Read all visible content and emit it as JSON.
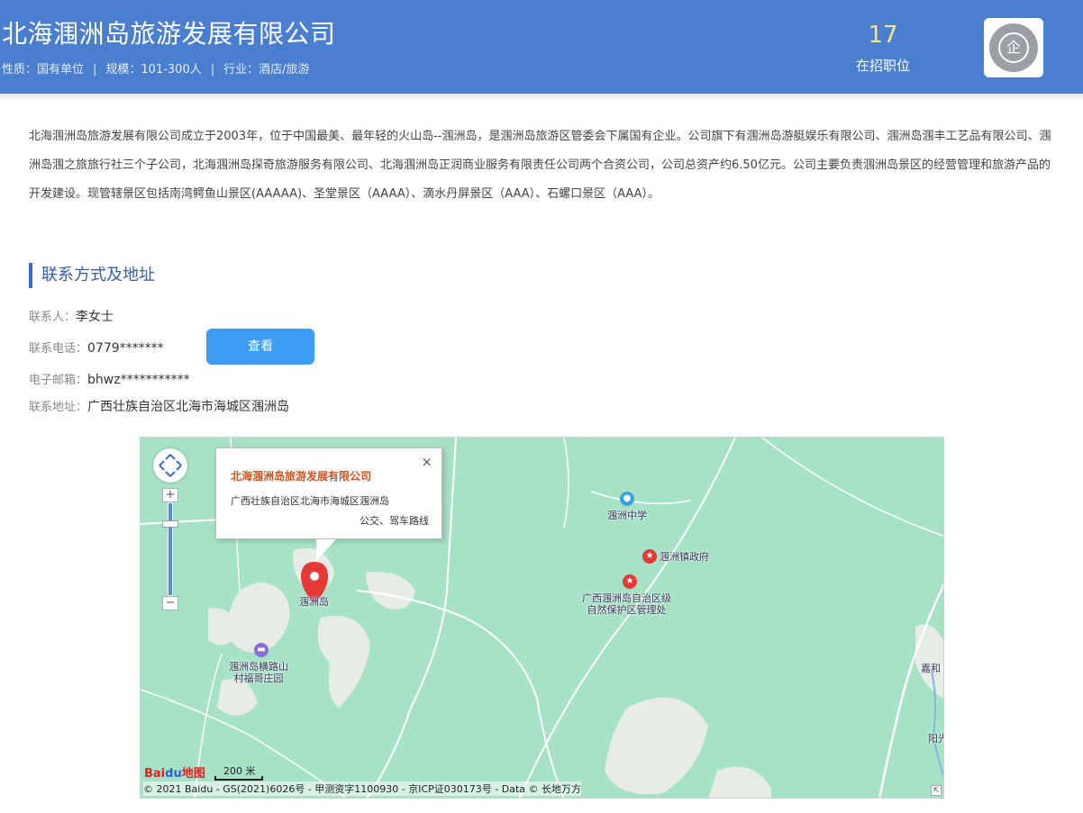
{
  "header": {
    "company_name": "北海涠洲岛旅游发展有限公司",
    "nature": "性质：国有单位",
    "scale": "规模：101-300人",
    "industry": "行业：酒店/旅游",
    "separator": "|",
    "jobs_count": "17",
    "jobs_label": "在招职位",
    "logo_char": "企"
  },
  "description": "北海涠洲岛旅游发展有限公司成立于2003年，位于中国最美、最年轻的火山岛--涠洲岛，是涠洲岛旅游区管委会下属国有企业。公司旗下有涠洲岛游艇娱乐有限公司、涠洲岛涠丰工艺品有限公司、涠洲岛涠之旅旅行社三个子公司，北海涠洲岛探奇旅游服务有限公司、北海涠洲岛正润商业服务有限责任公司两个合资公司，公司总资产约6.50亿元。公司主要负责涠洲岛景区的经营管理和旅游产品的开发建设。现管辖景区包括南湾鳄鱼山景区(AAAAA)、圣堂景区（AAAA）、滴水丹屏景区（AAA）、石螺口景区（AAA）。",
  "contact": {
    "section_title": "联系方式及地址",
    "person_label": "联系人：",
    "person_value": "李女士",
    "phone_label": "联系电话：",
    "phone_value": "0779*******",
    "view_button": "查看",
    "email_label": "电子邮箱：",
    "email_value": "bhwz***********",
    "address_label": "联系地址：",
    "address_value": "广西壮族自治区北海市海城区涠洲岛"
  },
  "map": {
    "popup_title": "北海涠洲岛旅游发展有限公司",
    "popup_address": "广西壮族自治区北海市海城区涠洲岛",
    "popup_links": "公交、驾车路线",
    "popup_close": "×",
    "marker_label": "涠洲岛",
    "labels": {
      "school": "涠洲中学",
      "gov": "涠洲镇政府",
      "reserve_1": "广西涠洲岛自治区级",
      "reserve_2": "自然保护区管理处",
      "village_1": "涠洲岛横路山",
      "village_2": "村福哥庄园",
      "right_1": "嘉和",
      "right_2": "阳光"
    },
    "zoom_in": "+",
    "zoom_out": "−",
    "baidu_logo_1": "Bai",
    "baidu_logo_paw": "du",
    "baidu_logo_2": "地图",
    "scale": "200 米",
    "copyright": "© 2021 Baidu - GS(2021)6026号 - 甲测资字1100930 - 京ICP证030173号 - Data © 长地万方"
  },
  "colors": {
    "header_bg": "#4a7fcf",
    "button_bg": "#3d9df5",
    "map_bg": "#a6e2c6",
    "popup_title": "#cc5522"
  }
}
